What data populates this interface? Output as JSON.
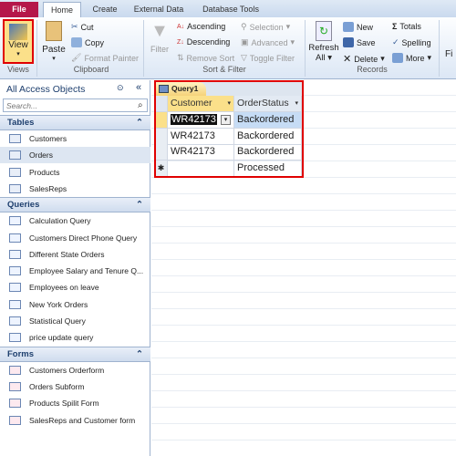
{
  "tabs": [
    "File",
    "Home",
    "Create",
    "External Data",
    "Database Tools"
  ],
  "ribbon": {
    "views": {
      "view": "View",
      "group": "Views"
    },
    "clipboard": {
      "paste": "Paste",
      "cut": "Cut",
      "copy": "Copy",
      "format_painter": "Format Painter",
      "group": "Clipboard"
    },
    "sort_filter": {
      "filter": "Filter",
      "ascending": "Ascending",
      "descending": "Descending",
      "remove_sort": "Remove Sort",
      "selection": "Selection",
      "advanced": "Advanced",
      "toggle_filter": "Toggle Filter",
      "group": "Sort & Filter"
    },
    "records": {
      "refresh": "Refresh",
      "refresh_all": "All",
      "new": "New",
      "save": "Save",
      "delete": "Delete",
      "totals": "Totals",
      "spelling": "Spelling",
      "more": "More",
      "group": "Records"
    },
    "find": "Fi"
  },
  "nav": {
    "title": "All Access Objects",
    "search_placeholder": "Search...",
    "sections": [
      {
        "label": "Tables",
        "items": [
          "Customers",
          "Orders",
          "Products",
          "SalesReps"
        ]
      },
      {
        "label": "Queries",
        "items": [
          "Calculation Query",
          "Customers Direct Phone Query",
          "Different State Orders",
          "Employee Salary and Tenure Q...",
          "Employees on leave",
          "New York Orders",
          "Statistical Query",
          "price update query"
        ]
      },
      {
        "label": "Forms",
        "items": [
          "Customers Orderform",
          "Orders Subform",
          "Products Spilit Form",
          "SalesReps and Customer form"
        ]
      }
    ]
  },
  "query": {
    "tab": "Query1",
    "columns": [
      "Customer",
      "OrderStatus"
    ],
    "rows": [
      [
        "WR42173",
        "Backordered"
      ],
      [
        "WR42173",
        "Backordered"
      ],
      [
        "WR42173",
        "Backordered"
      ],
      [
        "",
        "Processed"
      ]
    ],
    "new_row_marker": "✱"
  },
  "colors": {
    "highlight": "#e00000",
    "file_tab": "#b5174a",
    "selected_header": "#fbe08a"
  }
}
